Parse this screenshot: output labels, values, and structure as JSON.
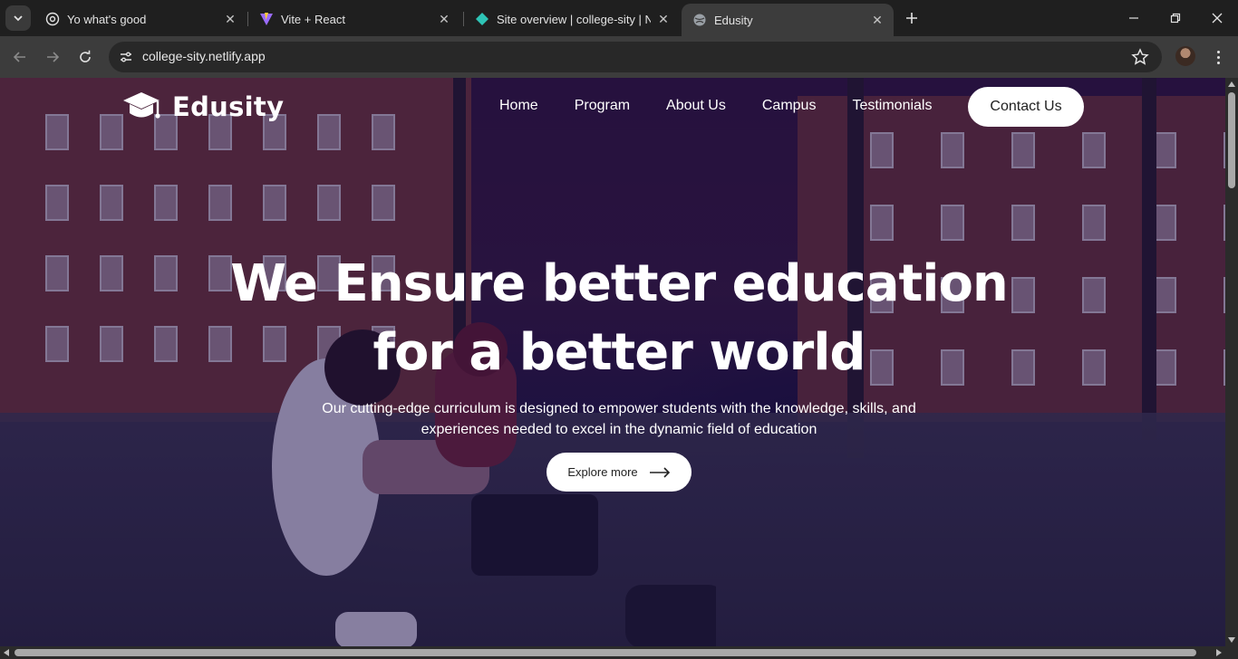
{
  "browser": {
    "tabs": [
      {
        "title": "Yo what's good",
        "icon": "openai-icon",
        "active": false
      },
      {
        "title": "Vite + React",
        "icon": "vite-icon",
        "active": false
      },
      {
        "title": "Site overview | college-sity | Netlify",
        "icon": "netlify-icon",
        "active": false
      },
      {
        "title": "Edusity",
        "icon": "globe-icon",
        "active": true
      }
    ],
    "url": "college-sity.netlify.app"
  },
  "site": {
    "logo_text": "Edusity",
    "nav": {
      "home": "Home",
      "program": "Program",
      "about": "About Us",
      "campus": "Campus",
      "testimonials": "Testimonials",
      "contact": "Contact Us"
    },
    "hero": {
      "title_line1": "We Ensure better education",
      "title_line2": "for a better world",
      "subtitle_line1": "Our cutting-edge curriculum is designed to empower students with the knowledge, skills, and",
      "subtitle_line2": "experiences needed to excel in the dynamic field of education",
      "cta": "Explore more"
    }
  },
  "colors": {
    "overlay": "#08003a",
    "chrome_bg": "#1f1f1f",
    "toolbar_bg": "#3c3c3c"
  }
}
